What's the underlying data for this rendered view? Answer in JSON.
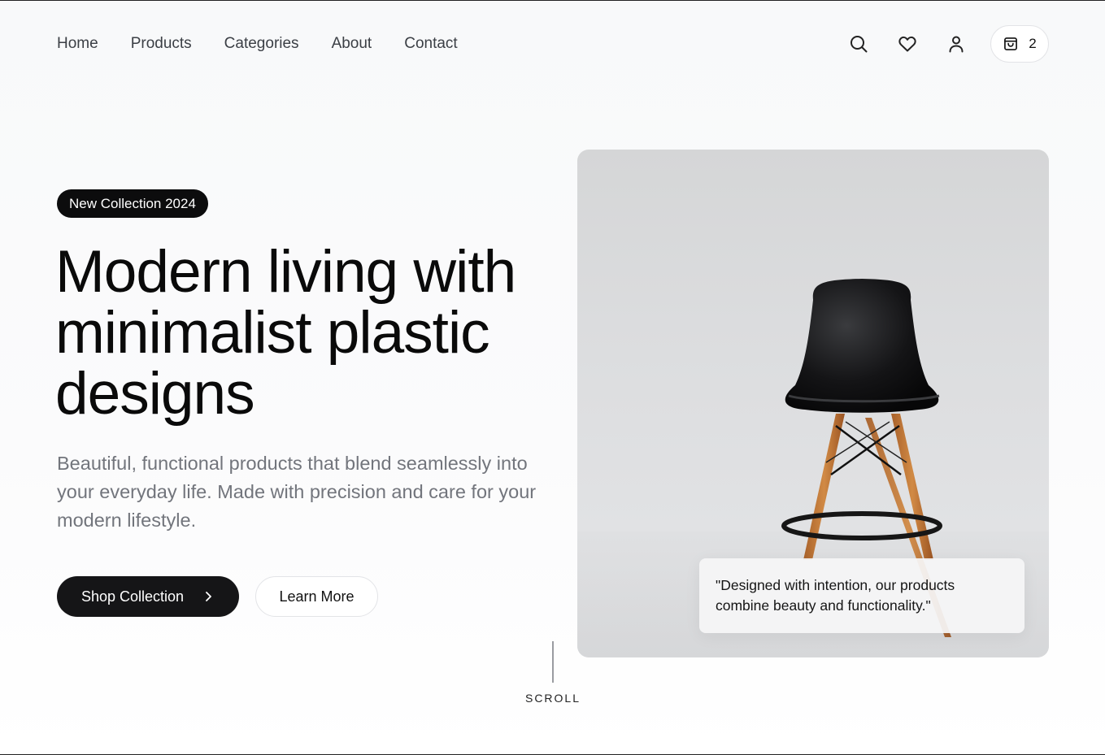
{
  "nav": {
    "links": [
      "Home",
      "Products",
      "Categories",
      "About",
      "Contact"
    ],
    "icons": [
      "search-icon",
      "heart-icon",
      "user-icon",
      "shopping-bag-icon"
    ],
    "cart_count": "2"
  },
  "hero": {
    "badge": "New Collection 2024",
    "title": "Modern living with minimalist plastic designs",
    "subtitle": "Beautiful, functional products that blend seamlessly into your everyday life. Made with precision and care for your modern lifestyle.",
    "primary_cta": "Shop Collection",
    "secondary_cta": "Learn More",
    "quote": "\"Designed with intention, our products combine beauty and functionality.\""
  },
  "scroll": {
    "label": "SCROLL"
  },
  "colors": {
    "accent": "#151517",
    "muted_text": "#72757c",
    "background": "#f9fafb"
  }
}
